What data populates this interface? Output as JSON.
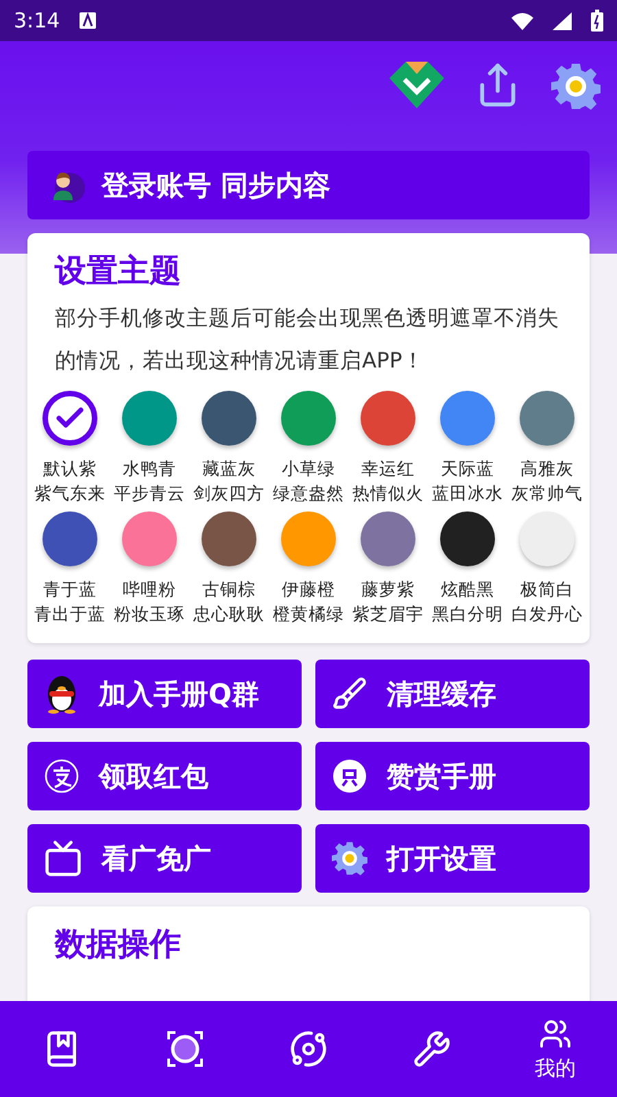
{
  "status_bar": {
    "time": "3:14"
  },
  "login": {
    "label": "登录账号 同步内容"
  },
  "theme_card": {
    "title": "设置主题",
    "note": "部分手机修改主题后可能会出现黑色透明遮罩不消失的情况，若出现这种情况请重启APP！",
    "themes": [
      {
        "name": "默认紫",
        "motto": "紫气东来",
        "color": "#6200ea",
        "selected": true
      },
      {
        "name": "水鸭青",
        "motto": "平步青云",
        "color": "#009688",
        "selected": false
      },
      {
        "name": "藏蓝灰",
        "motto": "剑灰四方",
        "color": "#3b5670",
        "selected": false
      },
      {
        "name": "小草绿",
        "motto": "绿意盎然",
        "color": "#0f9d58",
        "selected": false
      },
      {
        "name": "幸运红",
        "motto": "热情似火",
        "color": "#db4437",
        "selected": false
      },
      {
        "name": "天际蓝",
        "motto": "蓝田冰水",
        "color": "#4285f4",
        "selected": false
      },
      {
        "name": "高雅灰",
        "motto": "灰常帅气",
        "color": "#607d8b",
        "selected": false
      },
      {
        "name": "青于蓝",
        "motto": "青出于蓝",
        "color": "#3f51b5",
        "selected": false
      },
      {
        "name": "哔哩粉",
        "motto": "粉妆玉琢",
        "color": "#fb7299",
        "selected": false
      },
      {
        "name": "古铜棕",
        "motto": "忠心耿耿",
        "color": "#795548",
        "selected": false
      },
      {
        "name": "伊藤橙",
        "motto": "橙黄橘绿",
        "color": "#ff9800",
        "selected": false
      },
      {
        "name": "藤萝紫",
        "motto": "紫芝眉宇",
        "color": "#7e72a0",
        "selected": false
      },
      {
        "name": "炫酷黑",
        "motto": "黑白分明",
        "color": "#212121",
        "selected": false
      },
      {
        "name": "极简白",
        "motto": "白发丹心",
        "color": "#eeeeee",
        "selected": false
      }
    ]
  },
  "actions": [
    {
      "label": "加入手册Q群"
    },
    {
      "label": "清理缓存"
    },
    {
      "label": "领取红包"
    },
    {
      "label": "赞赏手册"
    },
    {
      "label": "看广免广"
    },
    {
      "label": "打开设置"
    }
  ],
  "data_card": {
    "title": "数据操作"
  },
  "bottom_nav": [
    {
      "selected": false
    },
    {
      "selected": false
    },
    {
      "selected": false
    },
    {
      "selected": false
    },
    {
      "label": "我的",
      "selected": true
    }
  ]
}
